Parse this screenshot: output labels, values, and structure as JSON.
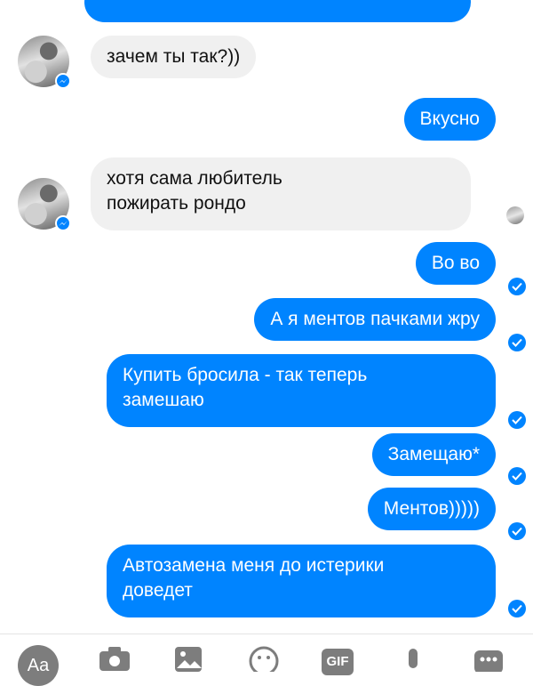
{
  "messages": [
    {
      "side": "in",
      "text": "зачем ты так?))"
    },
    {
      "side": "out",
      "text": "Вкусно"
    },
    {
      "side": "in",
      "text": "хотя сама любитель\nпожирать рондо"
    },
    {
      "side": "out",
      "text": "Во во"
    },
    {
      "side": "out",
      "text": "А я ментов пачками жру"
    },
    {
      "side": "out",
      "text": "Купить бросила - так теперь\nзамешаю"
    },
    {
      "side": "out",
      "text": "Замещаю*"
    },
    {
      "side": "out",
      "text": "Ментов)))))"
    },
    {
      "side": "out",
      "text": "Автозамена меня до истерики\nдоведет"
    }
  ],
  "composer": {
    "text_button": "Aa",
    "gif_button": "GIF",
    "icons": [
      "camera-icon",
      "image-icon",
      "emoji-icon",
      "microphone-icon",
      "more-icon"
    ]
  },
  "colors": {
    "outgoing": "#0084ff",
    "incoming": "#f0f0f0",
    "toolbar_icons": "#7d7d7d"
  }
}
